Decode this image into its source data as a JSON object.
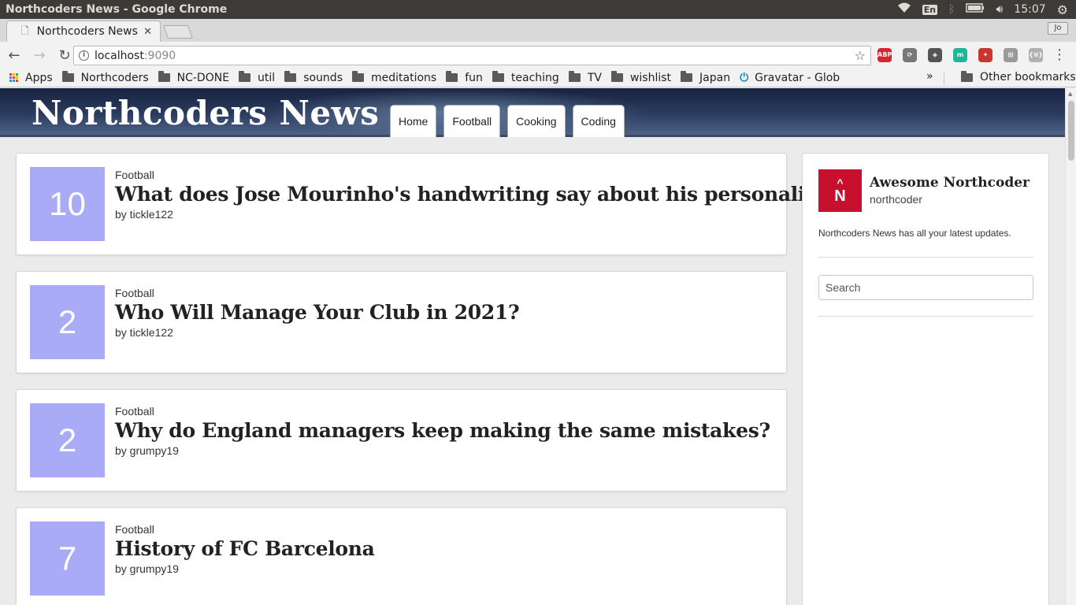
{
  "os": {
    "window_title": "Northcoders News - Google Chrome",
    "lang": "En",
    "clock": "15:07"
  },
  "browser": {
    "tab_title": "Northcoders News",
    "profile_label": "Jo",
    "url_host": "localhost",
    "url_port": ":9090",
    "bookmarks": [
      "Apps",
      "Northcoders",
      "NC-DONE",
      "util",
      "sounds",
      "meditations",
      "fun",
      "teaching",
      "TV",
      "wishlist",
      "Japan",
      "Gravatar - Global"
    ],
    "more_bookmarks": "»",
    "other_bookmarks": "Other bookmarks",
    "extensions": [
      {
        "name": "adblock-plus-icon",
        "label": "ABP",
        "color": "#d9232d"
      },
      {
        "name": "sync-icon",
        "label": "⟳",
        "color": "#777777"
      },
      {
        "name": "tag-icon",
        "label": "◈",
        "color": "#555555"
      },
      {
        "name": "m-extension-icon",
        "label": "m",
        "color": "#1fb59a"
      },
      {
        "name": "puzzle-red-icon",
        "label": "✦",
        "color": "#c8362e"
      },
      {
        "name": "grid-extension-icon",
        "label": "⊞",
        "color": "#9a9a9a"
      },
      {
        "name": "json-extension-icon",
        "label": "{≡}",
        "color": "#b0b0b0"
      }
    ]
  },
  "site": {
    "title": "Northcoders News",
    "nav": [
      "Home",
      "Football",
      "Cooking",
      "Coding"
    ]
  },
  "articles": [
    {
      "votes": "10",
      "topic": "Football",
      "title": "What does Jose Mourinho's handwriting say about his personality?",
      "author": "by tickle122"
    },
    {
      "votes": "2",
      "topic": "Football",
      "title": "Who Will Manage Your Club in 2021?",
      "author": "by tickle122"
    },
    {
      "votes": "2",
      "topic": "Football",
      "title": "Why do England managers keep making the same mistakes?",
      "author": "by grumpy19"
    },
    {
      "votes": "7",
      "topic": "Football",
      "title": "History of FC Barcelona",
      "author": "by grumpy19"
    }
  ],
  "sidebar": {
    "logo_caret": "^",
    "logo_letter": "N",
    "name": "Awesome Northcoder",
    "username": "northcoder",
    "description": "Northcoders News has all your latest updates.",
    "search_placeholder": "Search"
  },
  "colors": {
    "vote_box": "#a9abf7",
    "logo": "#c8102e",
    "header_dark": "#17233f"
  }
}
